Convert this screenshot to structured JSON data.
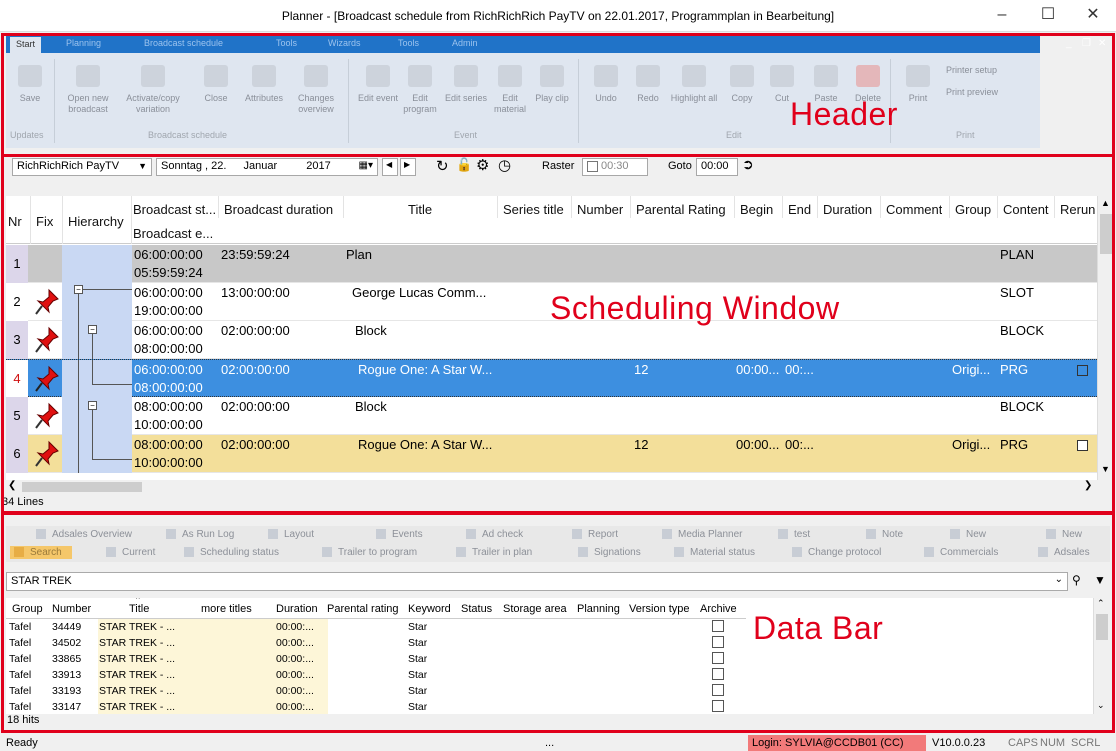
{
  "window": {
    "title": "Planner - [Broadcast schedule from RichRichRich PayTV on 22.01.2017, Programmplan in Bearbeitung]"
  },
  "ribbon": {
    "tabs": [
      "Start",
      "Planning",
      "Broadcast schedule",
      "Tools",
      "Wizards",
      "Tools",
      "Admin"
    ],
    "buttons": [
      "Save",
      "Open new broadcast",
      "Activate/copy variation",
      "Close",
      "Attributes",
      "Changes overview",
      "Edit event",
      "Edit program",
      "Edit series",
      "Edit material",
      "Play clip",
      "Undo",
      "Redo",
      "Highlight all",
      "Copy",
      "Cut",
      "Paste",
      "Delete",
      "Print"
    ],
    "groups": [
      "Updates",
      "Broadcast schedule",
      "Event",
      "Edit",
      "Print"
    ],
    "print_links": [
      "Printer setup",
      "Print preview"
    ]
  },
  "annotations": {
    "header": "Header",
    "scheduling": "Scheduling Window",
    "databar": "Data Bar"
  },
  "toolbar": {
    "channel": "RichRichRich PayTV",
    "date_day": "Sonntag",
    "date_num": ", 22.",
    "date_month": "Januar",
    "date_year": "2017",
    "raster_label": "Raster",
    "raster_value": "00:30",
    "goto_label": "Goto",
    "goto_value": "00:00"
  },
  "schedule": {
    "columns": [
      "Nr",
      "Fix",
      "Hierarchy",
      "Broadcast st...",
      "Broadcast duration",
      "Title",
      "Series title",
      "Number",
      "Parental Rating",
      "Begin",
      "End",
      "Duration",
      "Comment",
      "Group",
      "Content",
      "Rerun"
    ],
    "subheader": "Broadcast e...",
    "rows": [
      {
        "nr": "1",
        "start": "06:00:00:00",
        "end": "05:59:59:24",
        "duration": "23:59:59:24",
        "title": "Plan",
        "rating": "",
        "begin": "",
        "endt": "",
        "group": "",
        "content": "PLAN"
      },
      {
        "nr": "2",
        "start": "06:00:00:00",
        "end": "19:00:00:00",
        "duration": "13:00:00:00",
        "title": "George Lucas Comm...",
        "rating": "",
        "begin": "",
        "endt": "",
        "group": "",
        "content": "SLOT"
      },
      {
        "nr": "3",
        "start": "06:00:00:00",
        "end": "08:00:00:00",
        "duration": "02:00:00:00",
        "title": "Block",
        "rating": "",
        "begin": "",
        "endt": "",
        "group": "",
        "content": "BLOCK"
      },
      {
        "nr": "4",
        "start": "06:00:00:00",
        "end": "08:00:00:00",
        "duration": "02:00:00:00",
        "title": "Rogue One: A Star W...",
        "rating": "12",
        "begin": "00:00...",
        "endt": "00:...",
        "group": "Origi...",
        "content": "PRG"
      },
      {
        "nr": "5",
        "start": "08:00:00:00",
        "end": "10:00:00:00",
        "duration": "02:00:00:00",
        "title": "Block",
        "rating": "",
        "begin": "",
        "endt": "",
        "group": "",
        "content": "BLOCK"
      },
      {
        "nr": "6",
        "start": "08:00:00:00",
        "end": "10:00:00:00",
        "duration": "02:00:00:00",
        "title": "Rogue One: A Star W...",
        "rating": "12",
        "begin": "00:00...",
        "endt": "00:...",
        "group": "Origi...",
        "content": "PRG"
      }
    ],
    "line_count": "34 Lines"
  },
  "databar": {
    "tabs_row1": [
      "Adsales Overview",
      "As Run Log",
      "Layout",
      "Events",
      "Ad check",
      "Report",
      "Media Planner",
      "test",
      "Note",
      "New",
      "New"
    ],
    "tabs_row2": [
      "Search",
      "Current",
      "Scheduling status",
      "Trailer to program",
      "Trailer in plan",
      "Signations",
      "Material status",
      "Change protocol",
      "Commercials",
      "Adsales"
    ],
    "search_value": "STAR TREK",
    "columns": [
      "Group",
      "Number",
      "Title",
      "more titles",
      "Duration",
      "Parental rating",
      "Keyword",
      "Status",
      "Storage area",
      "Planning",
      "Version type",
      "Archive"
    ],
    "rows": [
      {
        "group": "Tafel",
        "number": "34449",
        "title": "STAR TREK - ...",
        "duration": "00:00:...",
        "keyword": "Star"
      },
      {
        "group": "Tafel",
        "number": "34502",
        "title": "STAR TREK - ...",
        "duration": "00:00:...",
        "keyword": "Star"
      },
      {
        "group": "Tafel",
        "number": "33865",
        "title": "STAR TREK - ...",
        "duration": "00:00:...",
        "keyword": "Star"
      },
      {
        "group": "Tafel",
        "number": "33913",
        "title": "STAR TREK - ...",
        "duration": "00:00:...",
        "keyword": "Star"
      },
      {
        "group": "Tafel",
        "number": "33193",
        "title": "STAR TREK - ...",
        "duration": "00:00:...",
        "keyword": "Star"
      },
      {
        "group": "Tafel",
        "number": "33147",
        "title": "STAR TREK - ...",
        "duration": "00:00:...",
        "keyword": "Star"
      }
    ],
    "hits": "18 hits"
  },
  "statusbar": {
    "ready": "Ready",
    "dots": "...",
    "login": "Login: SYLVIA@CCDB01 (CC)",
    "version": "V10.0.0.23",
    "caps": "CAPS",
    "num": "NUM",
    "scrl": "SCRL"
  },
  "colors": {
    "accent": "#2073c8",
    "selected_row": "#3d8fe0",
    "highlight_row": "#f3df9a",
    "plan_row": "#c8c8c8",
    "annotation": "#e0001b",
    "login_bg": "#f27a7a"
  }
}
